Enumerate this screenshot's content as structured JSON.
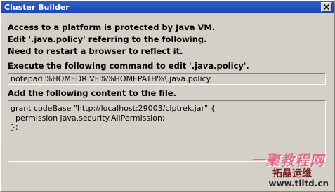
{
  "window": {
    "title": "Cluster Builder",
    "close_icon": "close-icon"
  },
  "message": {
    "line1": "Access to a platform is protected by Java VM.",
    "line2": "Edit '.java.policy' referring to the following.",
    "line3": "Need to restart a browser to reflect it."
  },
  "command": {
    "label": "Execute the following command to edit '.java.policy'.",
    "value": "notepad %HOMEDRIVE%%HOMEPATH%\\.java.policy"
  },
  "content": {
    "label": "Add the following content to the file.",
    "value": "grant codeBase \"http://localhost:29003/clptrek.jar\" {\n  permission java.security.AllPermission;\n};"
  },
  "watermark": {
    "line1": "一聚教程网",
    "line2": "拓晶运维",
    "line3": "www.tlltd.cn"
  },
  "colors": {
    "titlebar": "#1b46b0",
    "window_bg": "#d4d0c8"
  }
}
